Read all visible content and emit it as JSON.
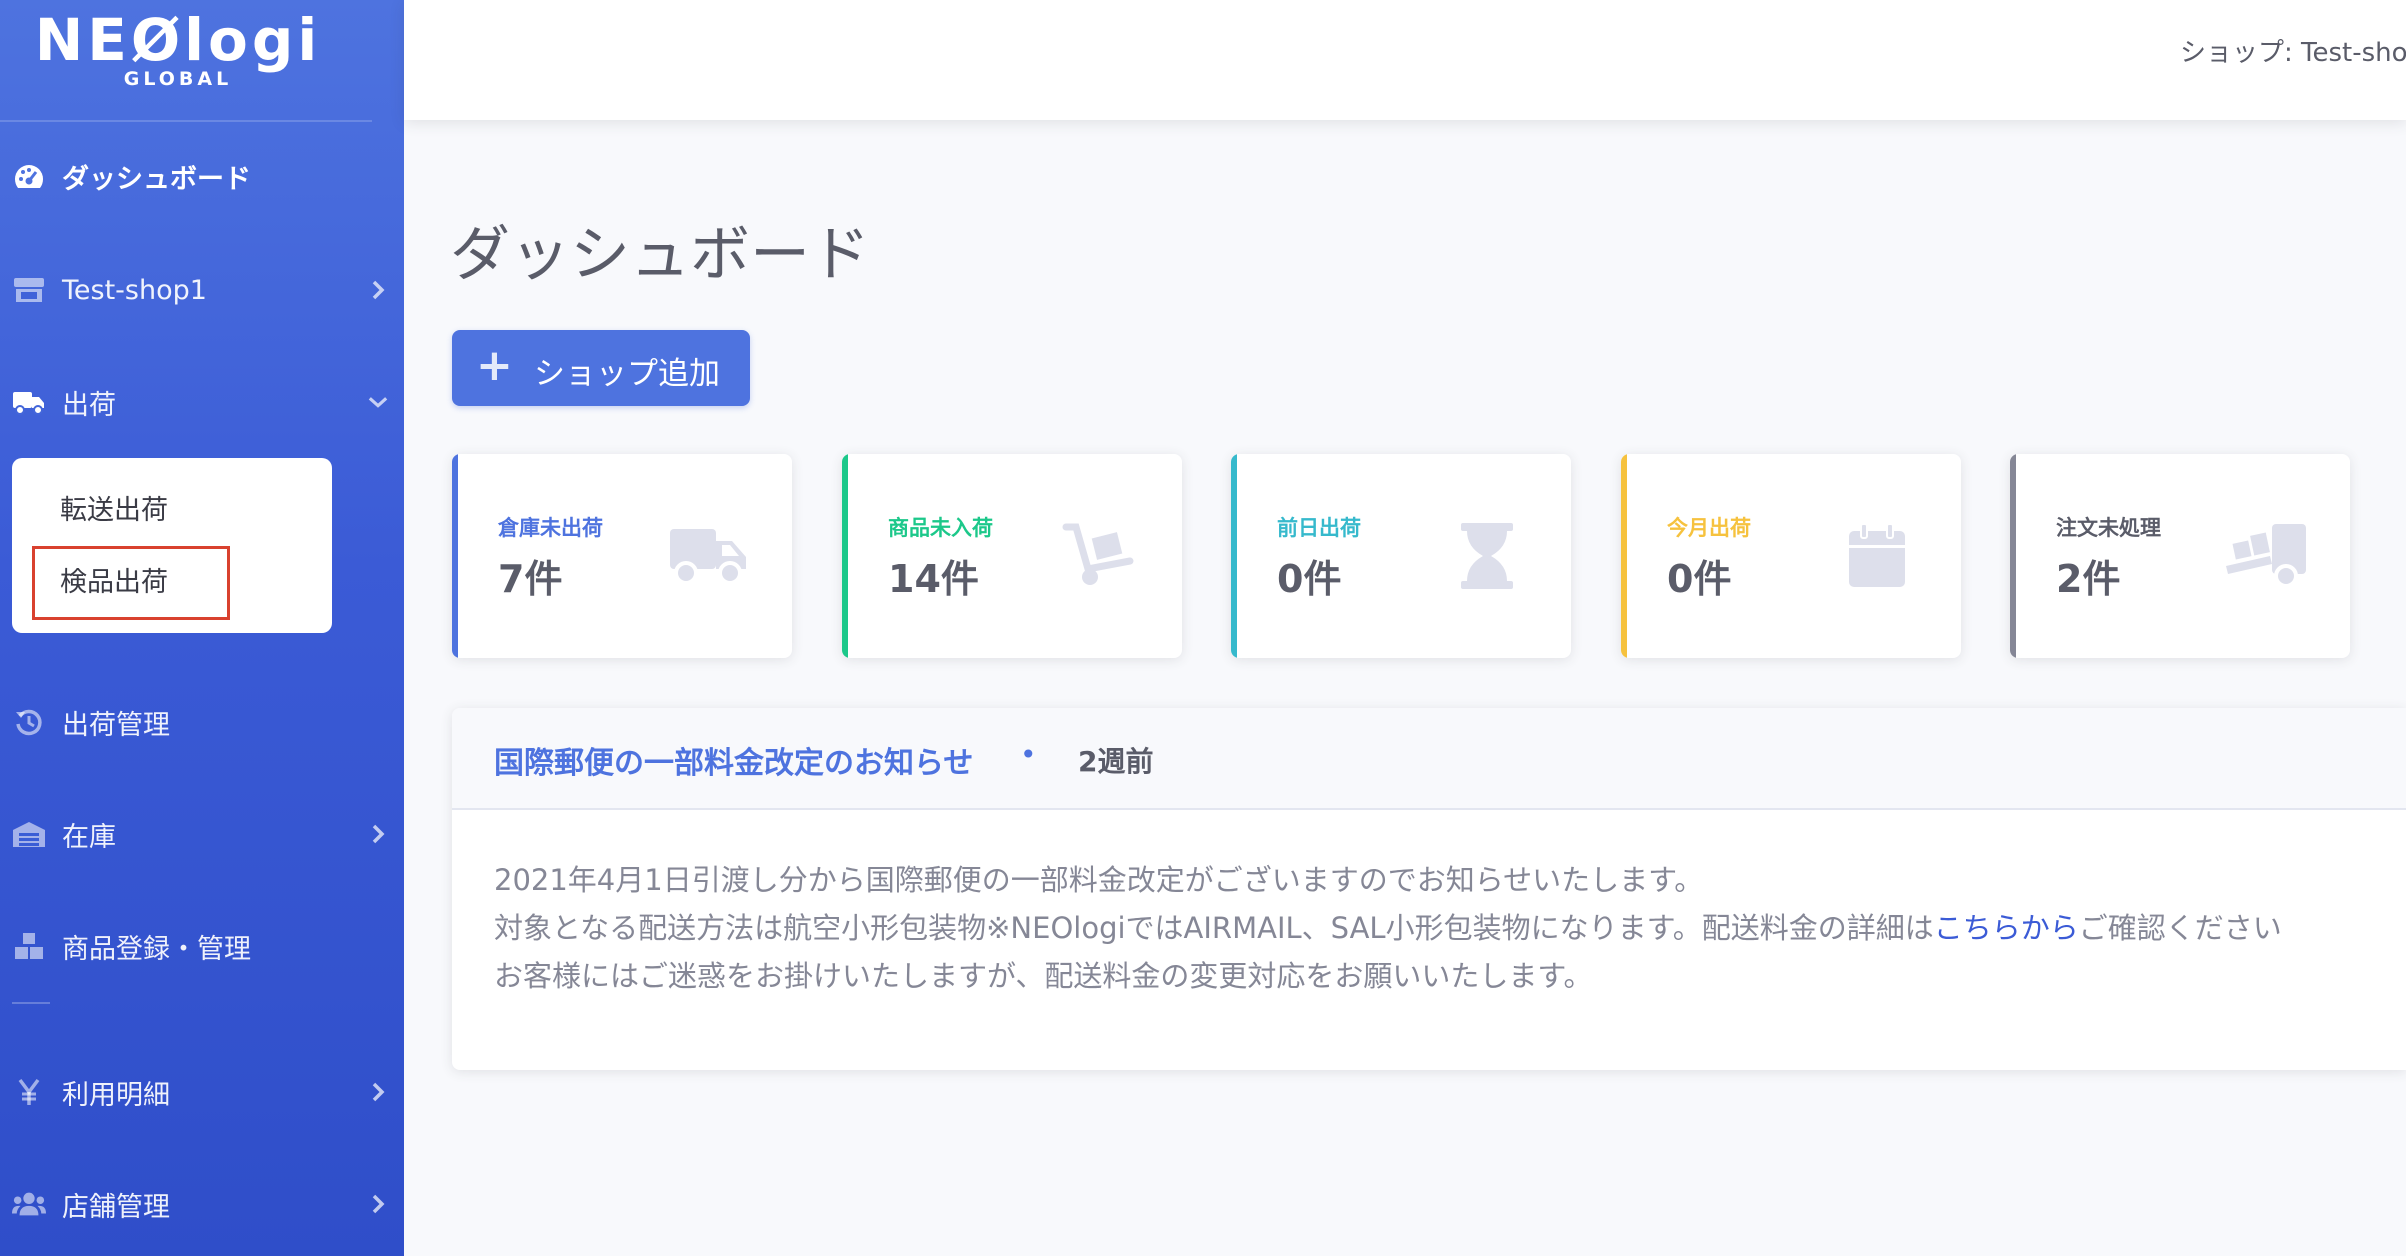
{
  "brand": {
    "name": "NEØlogi",
    "sub": "GLOBAL"
  },
  "colors": {
    "sidebar": "#4e73df",
    "primary": "#4e73df",
    "success": "#1cc88a",
    "info": "#36b9cc",
    "warning": "#f6c23e",
    "secondary": "#858796",
    "highlight_border": "#d9412f"
  },
  "sidebar": {
    "items": [
      {
        "label": "ダッシュボード",
        "icon": "tachometer-icon"
      },
      {
        "label": "Test-shop1",
        "icon": "store-icon"
      },
      {
        "label": "出荷",
        "icon": "truck-icon"
      },
      {
        "label": "出荷管理",
        "icon": "history-icon"
      },
      {
        "label": "在庫",
        "icon": "warehouse-icon"
      },
      {
        "label": "商品登録・管理",
        "icon": "boxes-icon"
      },
      {
        "label": "利用明細",
        "icon": "yen-icon"
      },
      {
        "label": "店舗管理",
        "icon": "users-icon"
      }
    ],
    "submenu": [
      "転送出荷",
      "検品出荷"
    ]
  },
  "topbar": {
    "shop_label": "ショップ: Test-shop"
  },
  "main": {
    "title": "ダッシュボード",
    "add_shop_label": "ショップ追加",
    "cards": [
      {
        "title": "倉庫未出荷",
        "value": "7件",
        "icon": "truck-icon"
      },
      {
        "title": "商品未入荷",
        "value": "14件",
        "icon": "dolly-icon"
      },
      {
        "title": "前日出荷",
        "value": "0件",
        "icon": "hourglass-icon"
      },
      {
        "title": "今月出荷",
        "value": "0件",
        "icon": "calendar-icon"
      },
      {
        "title": "注文未処理",
        "value": "2件",
        "icon": "truck-loading-icon"
      }
    ],
    "notice": {
      "title": "国際郵便の一部料金改定のお知らせ",
      "dot": "•",
      "time": "2週前",
      "lines": [
        "2021年4月1日引渡し分から国際郵便の一部料金改定がございますのでお知らせいたします。",
        "対象となる配送方法は航空小形包装物※NEOlogiではAIRMAIL、SAL小形包装物になります。配送料金の詳細は",
        "こちらから",
        "ご確認ください",
        "お客様にはご迷惑をお掛けいたしますが、配送料金の変更対応をお願いいたします。"
      ]
    }
  }
}
